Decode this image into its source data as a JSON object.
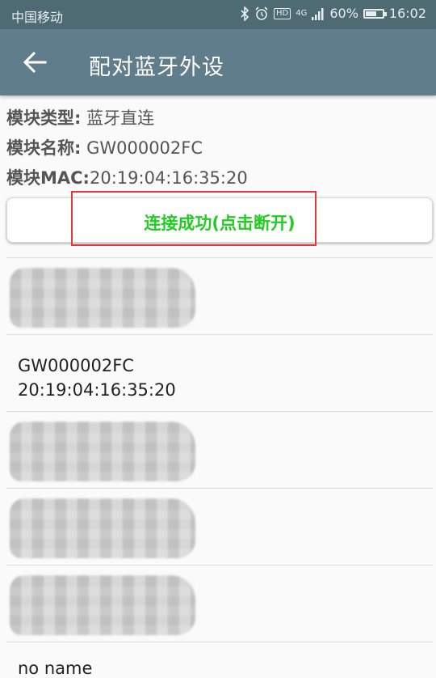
{
  "status_bar": {
    "carrier": "中国移动",
    "net": "4G",
    "hd": "HD",
    "battery_pct": "60%",
    "battery_level": 0.6,
    "time": "16:02"
  },
  "app_bar": {
    "title": "配对蓝牙外设"
  },
  "module": {
    "type_label": "模块类型:",
    "type_value": " 蓝牙直连",
    "name_label": "模块名称:",
    "name_value": " GW000002FC",
    "mac_label": "模块MAC:",
    "mac_value": "20:19:04:16:35:20"
  },
  "connect_button": {
    "label": "连接成功(点击断开)",
    "color": "#22cc22"
  },
  "devices": [
    {
      "name": "",
      "mac": ""
    },
    {
      "name": "GW000002FC",
      "mac": "20:19:04:16:35:20"
    },
    {
      "name": "",
      "mac": ""
    },
    {
      "name": "",
      "mac": ""
    },
    {
      "name": "",
      "mac": ""
    },
    {
      "name": "no name",
      "mac": ""
    }
  ],
  "colors": {
    "status_bar": "#4e6a73",
    "app_bar": "#607d8b",
    "highlight": "#e03a3a"
  }
}
